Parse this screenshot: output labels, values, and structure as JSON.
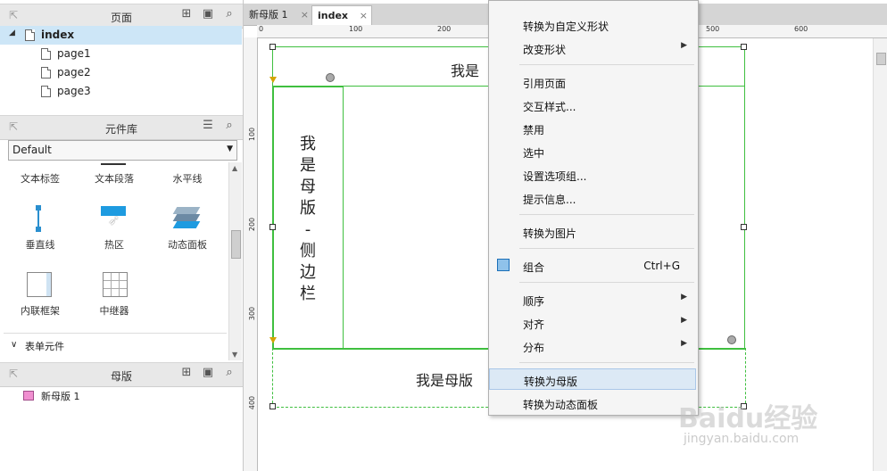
{
  "pages_panel": {
    "title": "页面",
    "items": [
      {
        "label": "index"
      },
      {
        "label": "page1"
      },
      {
        "label": "page2"
      },
      {
        "label": "page3"
      }
    ]
  },
  "library_panel": {
    "title": "元件库",
    "dropdown_value": "Default",
    "row1": [
      "文本标签",
      "文本段落",
      "水平线"
    ],
    "row2": [
      "垂直线",
      "热区",
      "动态面板"
    ],
    "row3": [
      "内联框架",
      "中继器"
    ],
    "group": "表单元件"
  },
  "masters_panel": {
    "title": "母版",
    "items": [
      {
        "label": "新母版 1"
      }
    ]
  },
  "tabs": [
    {
      "label": "新母版 1"
    },
    {
      "label": "index"
    }
  ],
  "ruler": {
    "h_labels": [
      "0",
      "100",
      "200",
      "500",
      "600"
    ],
    "v_labels": [
      "100",
      "200",
      "300",
      "400"
    ]
  },
  "canvas": {
    "top_text": "我是",
    "side_text": [
      "我",
      "是",
      "母",
      "版",
      "-",
      "侧",
      "边",
      "栏"
    ],
    "bottom_text": "我是母版"
  },
  "context_menu": {
    "items": [
      {
        "label": "转换为自定义形状"
      },
      {
        "label": "改变形状",
        "submenu": true
      },
      {
        "label": "引用页面"
      },
      {
        "label": "交互样式..."
      },
      {
        "label": "禁用"
      },
      {
        "label": "选中"
      },
      {
        "label": "设置选项组..."
      },
      {
        "label": "提示信息..."
      },
      {
        "label": "转换为图片"
      },
      {
        "label": "组合",
        "shortcut": "Ctrl+G"
      },
      {
        "label": "顺序",
        "submenu": true
      },
      {
        "label": "对齐",
        "submenu": true
      },
      {
        "label": "分布",
        "submenu": true
      },
      {
        "label": "转换为母版"
      },
      {
        "label": "转换为动态面板"
      }
    ]
  },
  "watermark": {
    "brand": "Baidu经验",
    "url": "jingyan.baidu.com"
  },
  "colors": {
    "accent_green": "#3fbf3f",
    "selected_row": "#cde6f7",
    "menu_highlight": "#dce9f5"
  }
}
